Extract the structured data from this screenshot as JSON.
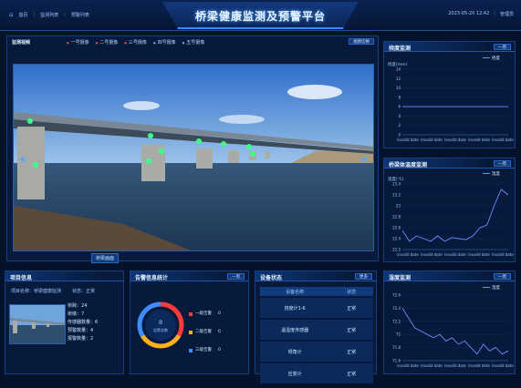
{
  "header": {
    "title": "桥梁健康监测及预警平台",
    "nav": [
      "首页",
      "监测列表",
      "预警列表"
    ],
    "datetime": "2023-05-20 12:42",
    "user": "管理员"
  },
  "video": {
    "label": "监测视频",
    "cams": [
      {
        "label": "一号摄像",
        "on": false
      },
      {
        "label": "二号摄像",
        "on": false
      },
      {
        "label": "三号摄像",
        "on": false
      },
      {
        "label": "四号摄像",
        "on": true
      },
      {
        "label": "五号摄像",
        "on": true
      }
    ],
    "button": "视频切换",
    "caption": "桥梁画面",
    "sensor_points": 9
  },
  "deflection_panel": {
    "title": "挠度监测",
    "button": "一周",
    "ylabel": "挠度(mm)",
    "legend": "挠度"
  },
  "temperature_panel": {
    "title": "桥梁体温度监测",
    "button": "一周",
    "ylabel": "温度(℃)",
    "legend": "温度"
  },
  "humidity_panel": {
    "title": "湿度监测",
    "button": "一周",
    "legend": "湿度"
  },
  "project_panel": {
    "title": "项目信息",
    "info": [
      "项目名称：桥梁健康监测",
      "状态：正常"
    ],
    "stats": [
      {
        "label": "桥跨",
        "value": "24"
      },
      {
        "label": "桥墩",
        "value": "7"
      },
      {
        "label": "传感器数量",
        "value": "6"
      },
      {
        "label": "预警数量",
        "value": "4"
      },
      {
        "label": "报警数量",
        "value": "2"
      }
    ]
  },
  "alarm_panel": {
    "title": "告警信息统计",
    "button": "一周",
    "center_value": "0",
    "center_label": "告警总数",
    "levels": [
      {
        "label": "一级告警",
        "value": "0",
        "color": "#ff3b3b"
      },
      {
        "label": "二级告警",
        "value": "0",
        "color": "#ffb020"
      },
      {
        "label": "三级告警",
        "value": "0",
        "color": "#3f8cff"
      }
    ]
  },
  "device_panel": {
    "title": "设备状态",
    "button": "更多",
    "columns": [
      "设备名称",
      "状态"
    ],
    "rows": [
      {
        "name": "挠度计1-6",
        "status": "正常"
      },
      {
        "name": "温湿度传感器",
        "status": "正常"
      },
      {
        "name": "倾角计",
        "status": "正常"
      },
      {
        "name": "应变计",
        "status": "正常"
      }
    ]
  },
  "chart_data": [
    {
      "type": "line",
      "title": "挠度监测",
      "ylabel": "挠度(mm)",
      "categories": [
        "Invalid date",
        "Invalid date",
        "Invalid date",
        "Invalid date",
        "Invalid date"
      ],
      "ylim": [
        0,
        14
      ],
      "yticks": [
        0,
        2,
        4,
        6,
        8,
        10,
        12,
        14
      ],
      "series": [
        {
          "name": "挠度",
          "values": [
            6,
            6,
            6,
            6,
            6,
            6,
            6,
            6,
            6,
            6,
            6,
            6
          ]
        }
      ]
    },
    {
      "type": "line",
      "title": "桥梁体温度监测",
      "ylabel": "温度(℃)",
      "categories": [
        "Invalid date",
        "Invalid date",
        "Invalid date",
        "Invalid date",
        "Invalid date"
      ],
      "ylim": [
        22.2,
        23.4
      ],
      "yticks": [
        22.2,
        22.4,
        22.6,
        22.8,
        23.0,
        23.2,
        23.4
      ],
      "series": [
        {
          "name": "温度",
          "values": [
            22.55,
            22.35,
            22.45,
            22.4,
            22.35,
            22.45,
            22.35,
            22.42,
            22.4,
            22.38,
            22.45,
            22.6,
            22.65,
            23.0,
            23.3,
            23.2
          ]
        }
      ]
    },
    {
      "type": "line",
      "title": "湿度监测",
      "categories": [
        "Invalid date",
        "Invalid date",
        "Invalid date",
        "Invalid date",
        "Invalid date"
      ],
      "ylim": [
        71.6,
        72.6
      ],
      "yticks": [
        71.6,
        71.8,
        72.0,
        72.2,
        72.4,
        72.6
      ],
      "series": [
        {
          "name": "湿度",
          "values": [
            72.4,
            72.25,
            72.1,
            72.05,
            72.0,
            71.95,
            72.0,
            71.9,
            71.95,
            71.85,
            71.9,
            71.8,
            71.7,
            71.85,
            71.75,
            71.8,
            71.7,
            71.75
          ]
        }
      ]
    }
  ]
}
